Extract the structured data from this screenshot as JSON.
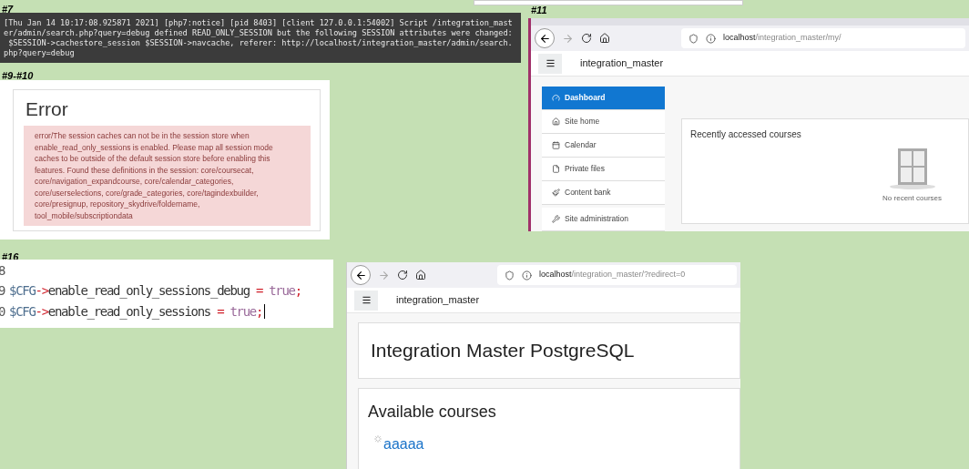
{
  "terminal_snapshot": {
    "caption": "#7",
    "lines": [
      "[Thu Jan 14 10:17:08.925871 2021] [php7:notice] [pid 8403] [client 127.0.0.1:54002] Script /integration_mast",
      "er/admin/search.php?query=debug defined READ_ONLY_SESSION but the following SESSION attributes were changed:",
      " $SESSION->cachestore_session $SESSION->navcache, referer: http://localhost/integration_master/admin/search.",
      "php?query=debug"
    ]
  },
  "error_snapshot": {
    "caption": "#9-#10",
    "heading": "Error",
    "message": "error/The session caches can not be in the session store when enable_read_only_sessions is enabled. Please map all session mode caches to be outside of the default session store before enabling this features. Found these definitions in the session: core/coursecat, core/navigation_expandcourse, core/calendar_categories, core/userselections, core/grade_categories, core/tagindexbuilder, core/presignup, repository_skydrive/foldername, tool_mobile/subscriptiondata"
  },
  "dashboard_snapshot": {
    "caption": "#11",
    "url_host": "localhost",
    "url_path": "/integration_master/my/",
    "site_name": "integration_master",
    "nav_items": [
      {
        "label": "Dashboard",
        "selected": true
      },
      {
        "label": "Site home",
        "selected": false
      },
      {
        "label": "Calendar",
        "selected": false
      },
      {
        "label": "Private files",
        "selected": false
      },
      {
        "label": "Content bank",
        "selected": false
      },
      {
        "label": "Site administration",
        "selected": false
      }
    ],
    "block_title": "Recently accessed courses",
    "empty_text": "No recent courses"
  },
  "code_snapshot": {
    "caption": "#16",
    "lines": [
      {
        "number": "8",
        "cursor": false
      },
      {
        "number": "9",
        "tokens": [
          {
            "kind": "var",
            "text": "$CFG"
          },
          {
            "kind": "op",
            "text": "->"
          },
          {
            "kind": "plain",
            "text": "enable_read_only_sessions_debug "
          },
          {
            "kind": "op",
            "text": "="
          },
          {
            "kind": "keyword",
            "text": " true"
          },
          {
            "kind": "op",
            "text": ";"
          }
        ],
        "cursor": false
      },
      {
        "number": "0",
        "tokens": [
          {
            "kind": "var",
            "text": "$CFG"
          },
          {
            "kind": "op",
            "text": "->"
          },
          {
            "kind": "plain",
            "text": "enable_read_only_sessions "
          },
          {
            "kind": "op",
            "text": "="
          },
          {
            "kind": "keyword",
            "text": " true"
          },
          {
            "kind": "op",
            "text": ";"
          }
        ],
        "cursor": true
      }
    ]
  },
  "frontpage_snapshot": {
    "url_host": "localhost",
    "url_path": "/integration_master/?redirect=0",
    "site_name": "integration_master",
    "site_title": "Integration Master PostgreSQL",
    "section_title": "Available courses",
    "courses": [
      "aaaaa"
    ]
  }
}
